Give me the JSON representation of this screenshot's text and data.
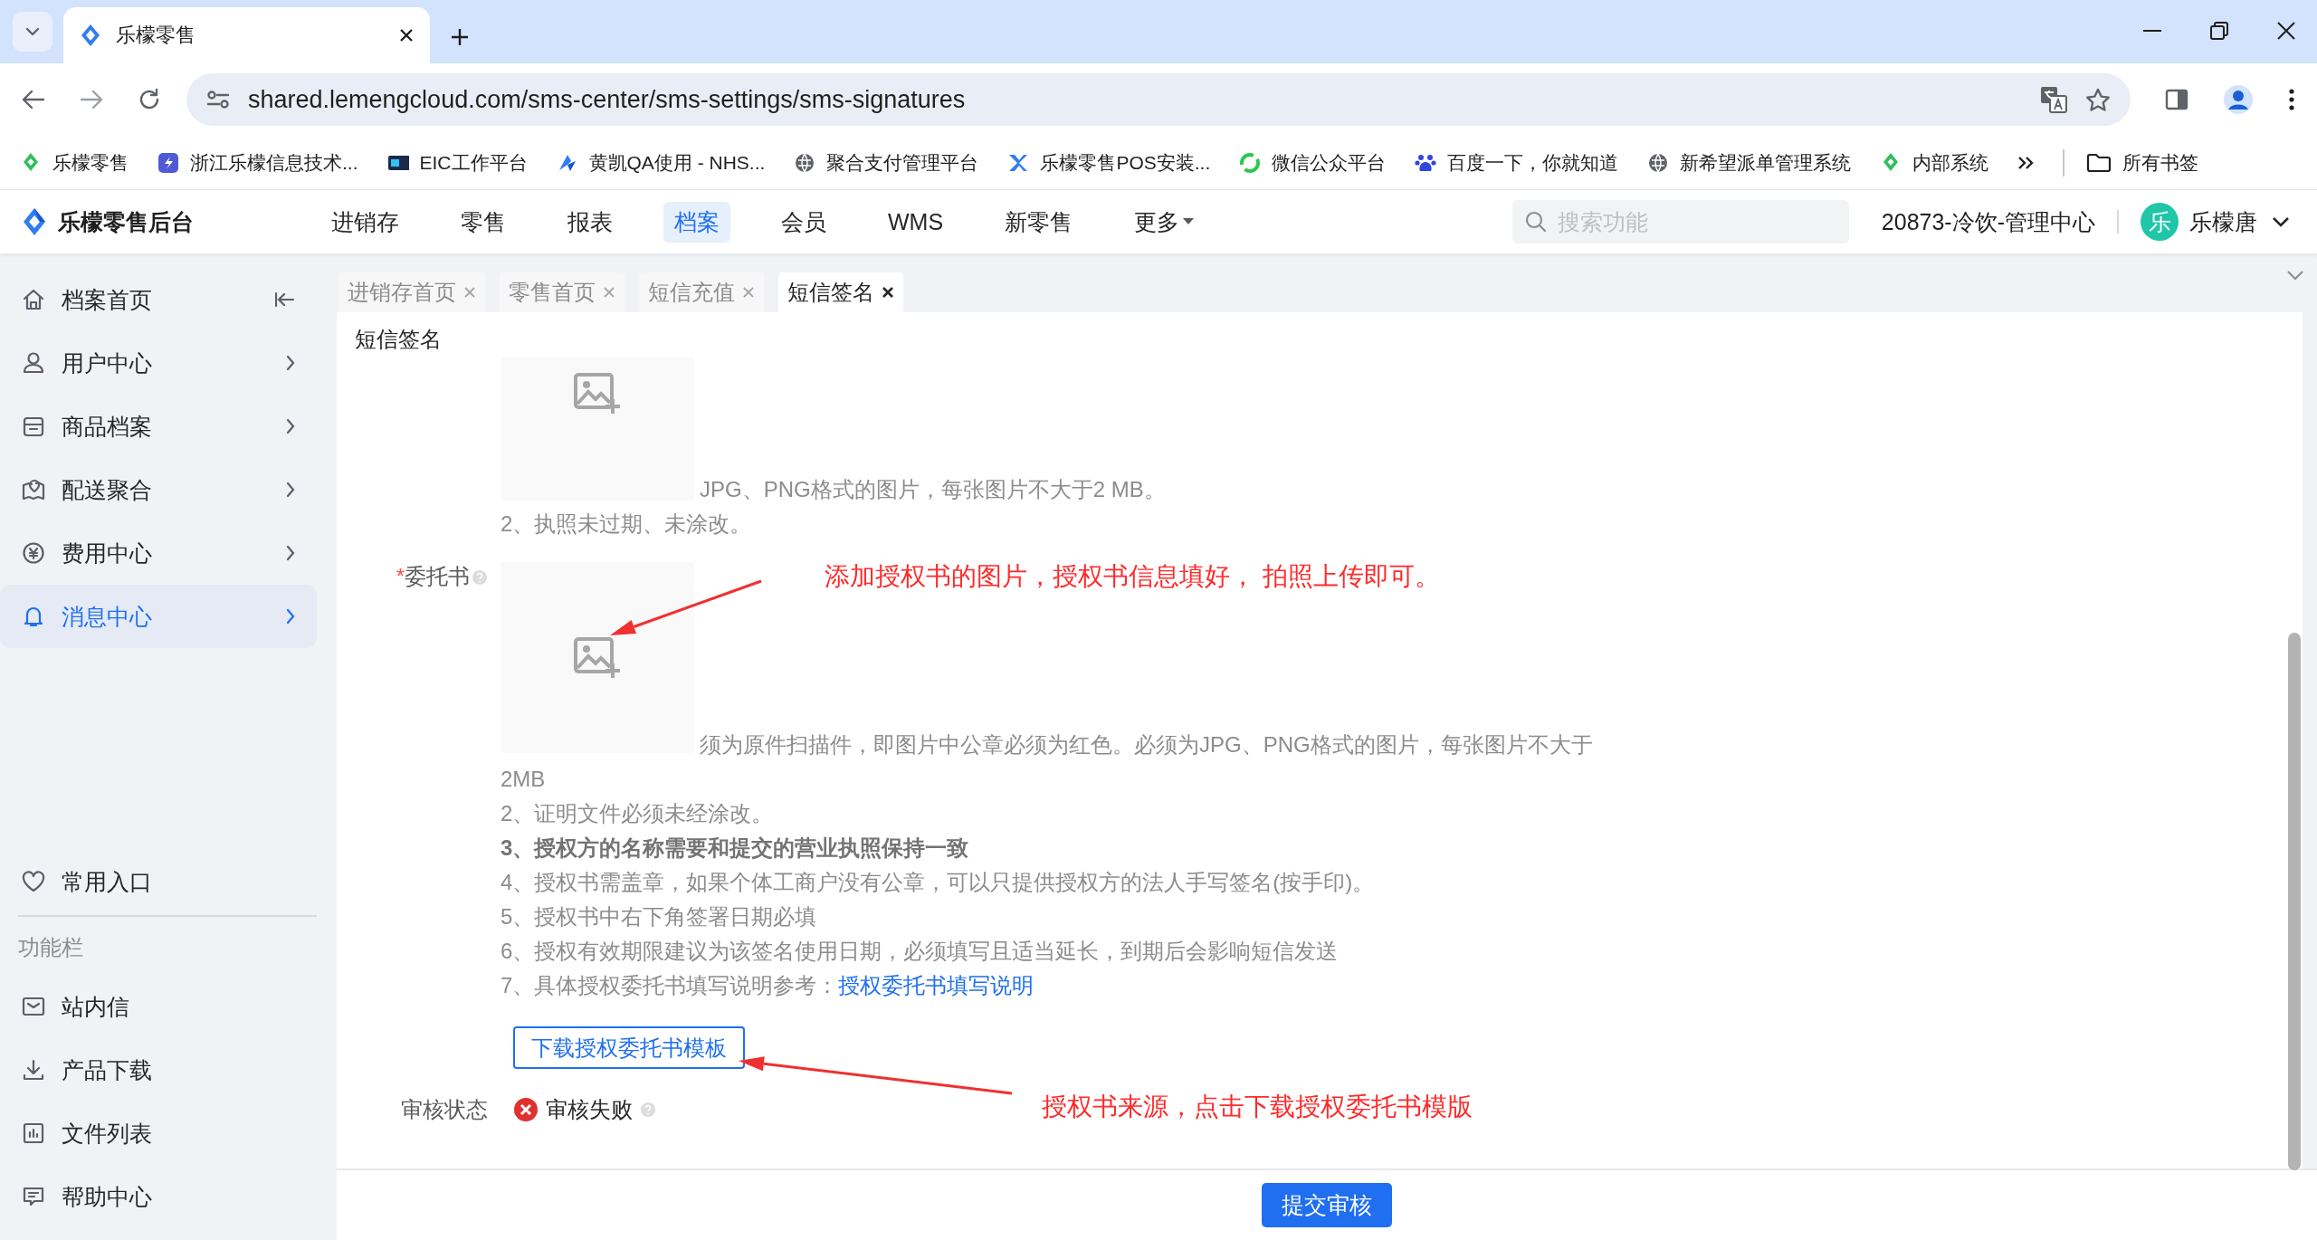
{
  "browser": {
    "tabs": [
      {
        "title": "乐檬零售",
        "selected": true
      }
    ],
    "url": "shared.lemengcloud.com/sms-center/sms-settings/sms-signatures",
    "bookmarks": [
      "乐檬零售",
      "浙江乐檬信息技术...",
      "EIC工作平台",
      "黄凯QA使用 - NHS...",
      "聚合支付管理平台",
      "乐檬零售POS安装...",
      "微信公众平台",
      "百度一下，你就知道",
      "新希望派单管理系统",
      "内部系统"
    ],
    "all_bookmarks": "所有书签"
  },
  "app": {
    "logo": "乐檬零售后台",
    "nav": [
      {
        "label": "进销存",
        "selected": false
      },
      {
        "label": "零售",
        "selected": false
      },
      {
        "label": "报表",
        "selected": false
      },
      {
        "label": "档案",
        "selected": true
      },
      {
        "label": "会员",
        "selected": false
      },
      {
        "label": "WMS",
        "selected": false
      },
      {
        "label": "新零售",
        "selected": false
      },
      {
        "label": "更多",
        "selected": false,
        "kind": "dropdown"
      }
    ],
    "search": {
      "placeholder": "搜索功能"
    },
    "store": "20873-冷饮-管理中心",
    "user": {
      "avatar": "乐",
      "name": "乐檬唐"
    }
  },
  "sidebar": {
    "items": [
      {
        "label": "档案首页",
        "selected": false,
        "kind": "home"
      },
      {
        "label": "用户中心",
        "selected": false,
        "kind": "menu"
      },
      {
        "label": "商品档案",
        "selected": false,
        "kind": "menu"
      },
      {
        "label": "配送聚合",
        "selected": false,
        "kind": "menu"
      },
      {
        "label": "费用中心",
        "selected": false,
        "kind": "menu"
      },
      {
        "label": "消息中心",
        "selected": true,
        "kind": "menu"
      }
    ],
    "favorites": "常用入口",
    "section_title": "功能栏",
    "tools": [
      "站内信",
      "产品下载",
      "文件列表",
      "帮助中心"
    ]
  },
  "page_tabs": [
    {
      "label": "进销存首页",
      "selected": false
    },
    {
      "label": "零售首页",
      "selected": false
    },
    {
      "label": "短信充值",
      "selected": false
    },
    {
      "label": "短信签名",
      "selected": true
    }
  ],
  "form": {
    "title": "短信签名",
    "license_hints": [
      "JPG、PNG格式的图片，每张图片不大于2 MB。",
      "2、执照未过期、未涂改。"
    ],
    "authorization": {
      "required_mark": "*",
      "label": "委托书",
      "hints": [
        {
          "kind": "plain",
          "text": "须为原件扫描件，即图片中公章必须为红色。必须为JPG、PNG格式的图片，每张图片不大于"
        },
        {
          "kind": "plain",
          "text": "2MB"
        },
        {
          "kind": "plain",
          "text": "2、证明文件必须未经涂改。"
        },
        {
          "kind": "bold",
          "text": "3、授权方的名称需要和提交的营业执照保持一致"
        },
        {
          "kind": "plain",
          "text": "4、授权书需盖章，如果个体工商户没有公章，可以只提供授权方的法人手写签名(按手印)。"
        },
        {
          "kind": "plain",
          "text": "5、授权书中右下角签署日期必填"
        },
        {
          "kind": "plain",
          "text": "6、授权有效期限建议为该签名使用日期，必须填写且适当延长，到期后会影响短信发送"
        },
        {
          "kind": "link",
          "text": "7、具体授权委托书填写说明参考：",
          "link": "授权委托书填写说明"
        }
      ],
      "download_button": "下载授权委托书模板"
    },
    "review": {
      "label": "审核状态",
      "status": "审核失败",
      "rejected": true
    }
  },
  "submit_button": "提交审核",
  "annotations": [
    {
      "text": "添加授权书的图片，授权书信息填好， 拍照上传即可。"
    },
    {
      "text": "授权书来源，点击下载授权委托书模版"
    }
  ]
}
